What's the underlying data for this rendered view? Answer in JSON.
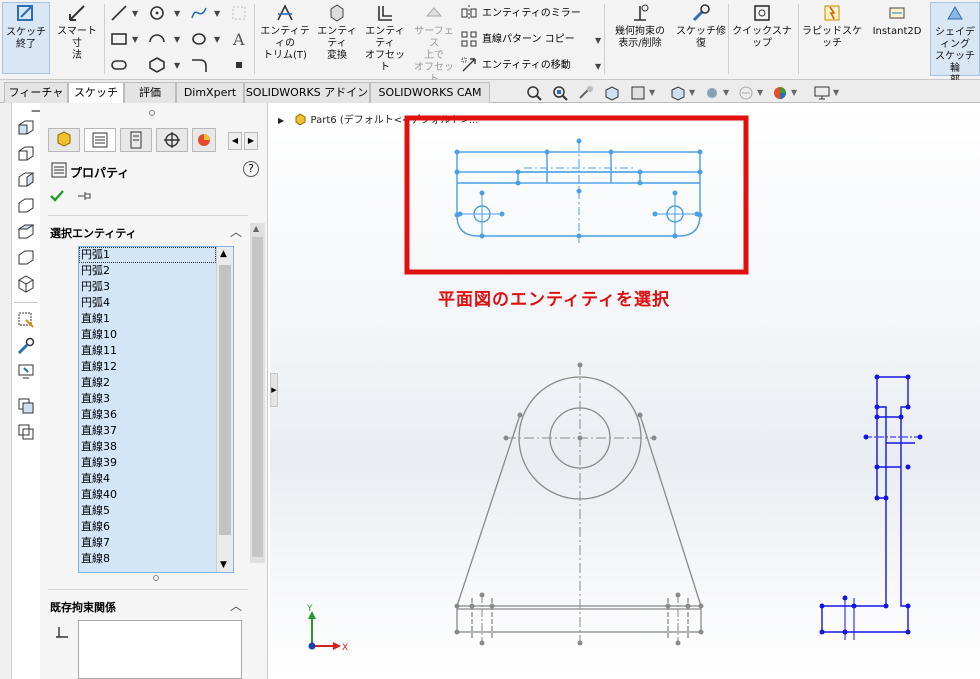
{
  "ribbon": {
    "sketch_exit": "スケッチ\n終了",
    "smart_dim": "スマート寸\n法",
    "trim": "エンティティの\nトリム(T)",
    "convert": "エンティティ\n変換",
    "offset": "エンティティ\nオフセット",
    "surface_offset": "サーフェス\n上で\nオフセット",
    "mirror": "エンティティのミラー",
    "linear_pattern": "直線パターン コピー",
    "move": "エンティティの移動",
    "relations": "幾何拘束の\n表示/削除",
    "repair": "スケッチ修\n復",
    "quick_snap": "クイックスナップ",
    "rapid_sketch": "ラピッドスケッチ",
    "instant2d": "Instant2D",
    "shaded_sketch": "シェイディング\nスケッチ輪\n郭"
  },
  "tabs": [
    "フィーチャー",
    "スケッチ",
    "評価",
    "DimXpert",
    "SOLIDWORKS アドイン",
    "SOLIDWORKS CAM"
  ],
  "active_tab": "スケッチ",
  "property_manager": {
    "title": "プロパティ",
    "help": "?",
    "selected_entities_header": "選択エンティティ",
    "existing_relations_header": "既存拘束関係",
    "entities": [
      "円弧1",
      "円弧2",
      "円弧3",
      "円弧4",
      "直線1",
      "直線10",
      "直線11",
      "直線12",
      "直線2",
      "直線3",
      "直線36",
      "直線37",
      "直線38",
      "直線39",
      "直線4",
      "直線40",
      "直線5",
      "直線6",
      "直線7",
      "直線8"
    ]
  },
  "graphics": {
    "tree_label": "Part6 (デフォルト<<デフォルト>...",
    "callout": "平面図のエンティティを選択",
    "axis_y": "Y",
    "axis_x": "X"
  },
  "colors": {
    "selection_blue": "#4a9fe8",
    "sketch_blue": "#1414e6",
    "callout_red": "#e01010",
    "geometry_gray": "#8a8a8a"
  }
}
